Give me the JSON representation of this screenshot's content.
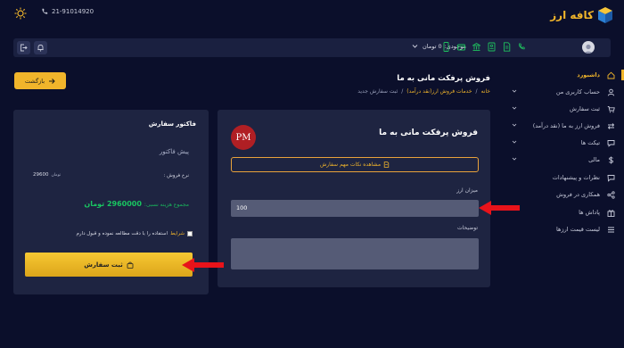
{
  "header": {
    "logo_text": "کافه ارز",
    "phone": "21-91014920"
  },
  "toolbar": {
    "balance_label": "موجودی:",
    "balance_value": "0 تومان"
  },
  "sidebar": {
    "items": [
      {
        "label": "داشبورد",
        "icon": "home-icon",
        "active": true
      },
      {
        "label": "حساب کاربری من",
        "icon": "user-icon"
      },
      {
        "label": "ثبت سفارش",
        "icon": "cart-icon"
      },
      {
        "label": "فروش ارز به ما (نقد درآمد)",
        "icon": "exchange-icon"
      },
      {
        "label": "تیکت ها",
        "icon": "chat-icon"
      },
      {
        "label": "مالی",
        "icon": "dollar-icon"
      },
      {
        "label": "نظرات و پیشنهادات",
        "icon": "comment-icon"
      },
      {
        "label": "همکاری در فروش",
        "icon": "share-icon"
      },
      {
        "label": "پاداش ها",
        "icon": "gift-icon"
      },
      {
        "label": "لیست قیمت ارزها",
        "icon": "list-icon"
      }
    ]
  },
  "page": {
    "title": "فروش پرفکت مانی به ما",
    "breadcrumb": [
      "خانه",
      "خدمات فروش ارز(نقد درآمد)",
      "ثبت سفارش جدید"
    ],
    "back_label": "بازگشت"
  },
  "order_form": {
    "title": "فروش پرفکت مانی به ما",
    "logo_text": "PM",
    "notes_label": "مشاهده نکات مهم سفارش",
    "amount_label": "میزان ارز",
    "amount_value": "100",
    "description_label": "توضیحات",
    "description_value": ""
  },
  "invoice": {
    "title": "فاکتور سفارش",
    "subtitle": "پیش فاکتور",
    "rate_label": "نرخ فروش :",
    "rate_value": "29600",
    "rate_unit": "تومان",
    "total_label": "مجموع هزینه نسبی:",
    "total_value": "2960000 تومان",
    "terms_link": "شرایط",
    "terms_text": "استفاده را با دقت مطالعه نموده و قبول دارم",
    "submit_label": "ثبت سفارش"
  },
  "colors": {
    "accent": "#f1b52b",
    "background": "#0b0f2b",
    "card": "#1e2441",
    "success": "#19c561",
    "arrow": "#e8131a"
  }
}
